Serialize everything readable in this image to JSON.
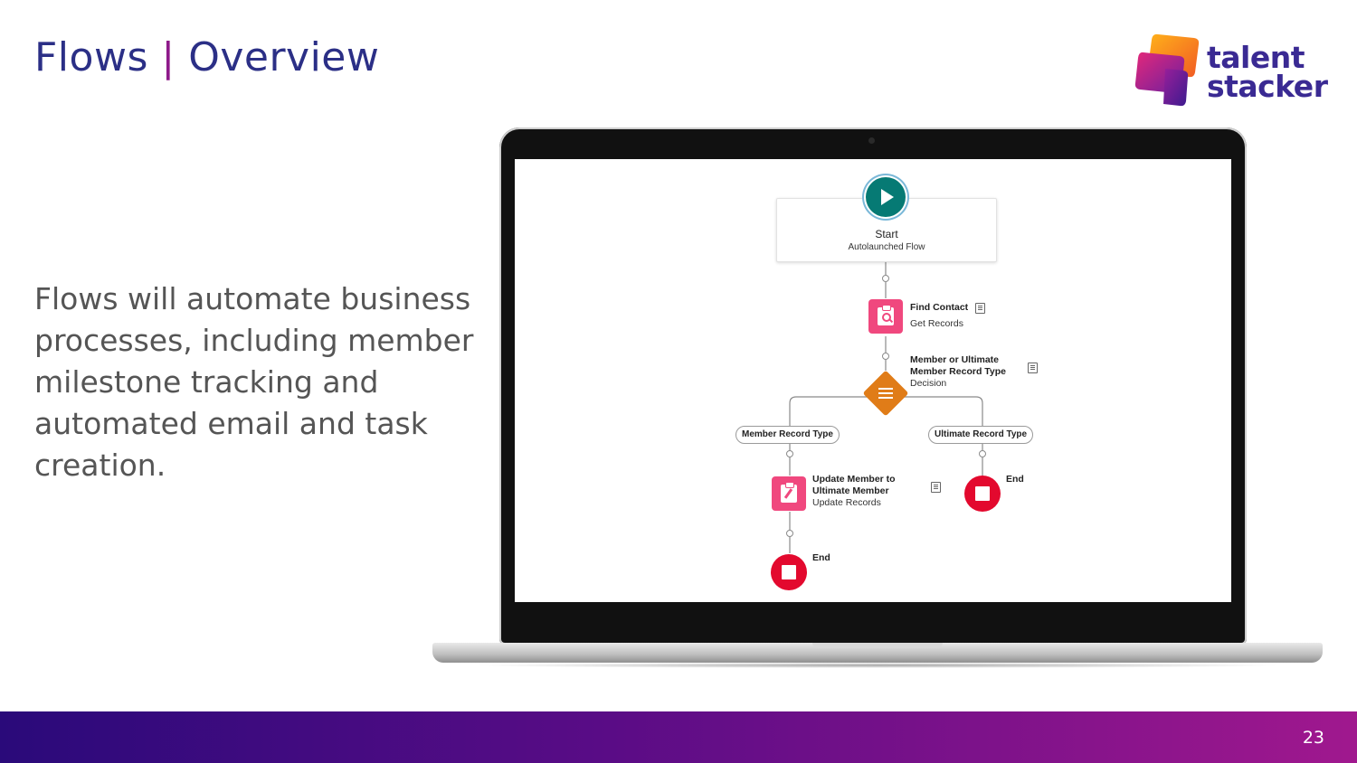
{
  "slide": {
    "title_left": "Flows",
    "title_sep": "|",
    "title_right": "Overview",
    "body": "Flows will automate business processes, including member milestone tracking and automated email and task creation.",
    "page_number": "23"
  },
  "logo": {
    "line1": "talent",
    "line2": "stacker"
  },
  "flow": {
    "start_title": "Start",
    "start_subtitle": "Autolaunched Flow",
    "find_contact_title": "Find Contact",
    "find_contact_type": "Get Records",
    "decision_title_line1": "Member or Ultimate",
    "decision_title_line2": "Member Record Type",
    "decision_type": "Decision",
    "branch_left": "Member Record Type",
    "branch_right": "Ultimate Record Type",
    "update_title_line1": "Update Member to",
    "update_title_line2": "Ultimate Member",
    "update_type": "Update Records",
    "end_label_right": "End",
    "end_label_bottom": "End"
  },
  "colors": {
    "title": "#2b2f86",
    "title_separator": "#8e1a8a",
    "start_icon": "#067a74",
    "record_icon": "#f0487e",
    "decision_icon": "#e07c18",
    "end_icon": "#e3092e",
    "footer_gradient_start": "#2a0a7a",
    "footer_gradient_end": "#a0188e"
  }
}
